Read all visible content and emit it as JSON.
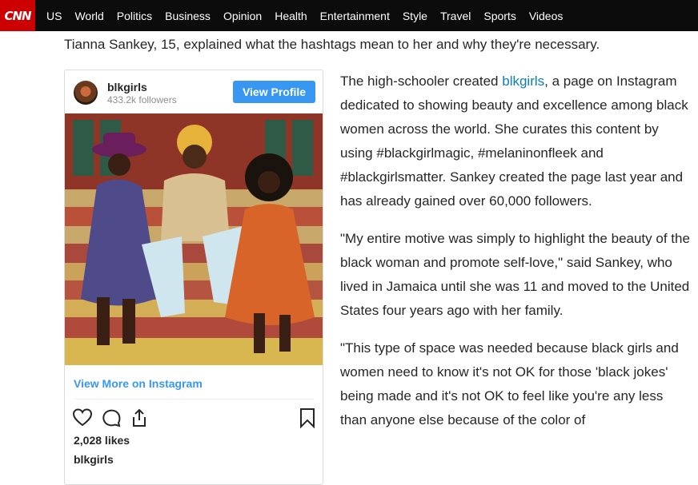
{
  "nav": {
    "logo": "CNN",
    "items": [
      "US",
      "World",
      "Politics",
      "Business",
      "Opinion",
      "Health",
      "Entertainment",
      "Style",
      "Travel",
      "Sports",
      "Videos"
    ]
  },
  "lead": "Tianna Sankey, 15, explained what the hashtags mean to her and why they're necessary.",
  "embed": {
    "username": "blkgirls",
    "followers": "433.2k followers",
    "view_profile": "View Profile",
    "view_more": "View More on Instagram",
    "likes": "2,028 likes",
    "owner": "blkgirls"
  },
  "article": {
    "p1_before": "The high-schooler created ",
    "p1_link": "blkgirls",
    "p1_after": ", a page on Instagram dedicated to showing beauty and excellence among black women across the world. She curates this content by using #blackgirlmagic, #melaninonfleek and #blackgirlsmatter. Sankey created the page last year and has already gained over 60,000 followers.",
    "p2": "\"My entire motive was simply to highlight the beauty of the black woman and promote self-love,\" said Sankey, who lived in Jamaica until she was 11 and moved to the United States four years ago with her family.",
    "p3": "\"This type of space was needed because black girls and women need to know it's not OK for those 'black jokes' being made and it's not OK to feel like you're any less than anyone else because of the color of"
  },
  "colors": {
    "cnn_red": "#cc0000",
    "nav_bg": "#0c0c0c",
    "instagram_blue": "#3897f0",
    "link": "#0c7eb5"
  },
  "icons": [
    "heart-icon",
    "comment-icon",
    "share-icon",
    "bookmark-icon"
  ]
}
